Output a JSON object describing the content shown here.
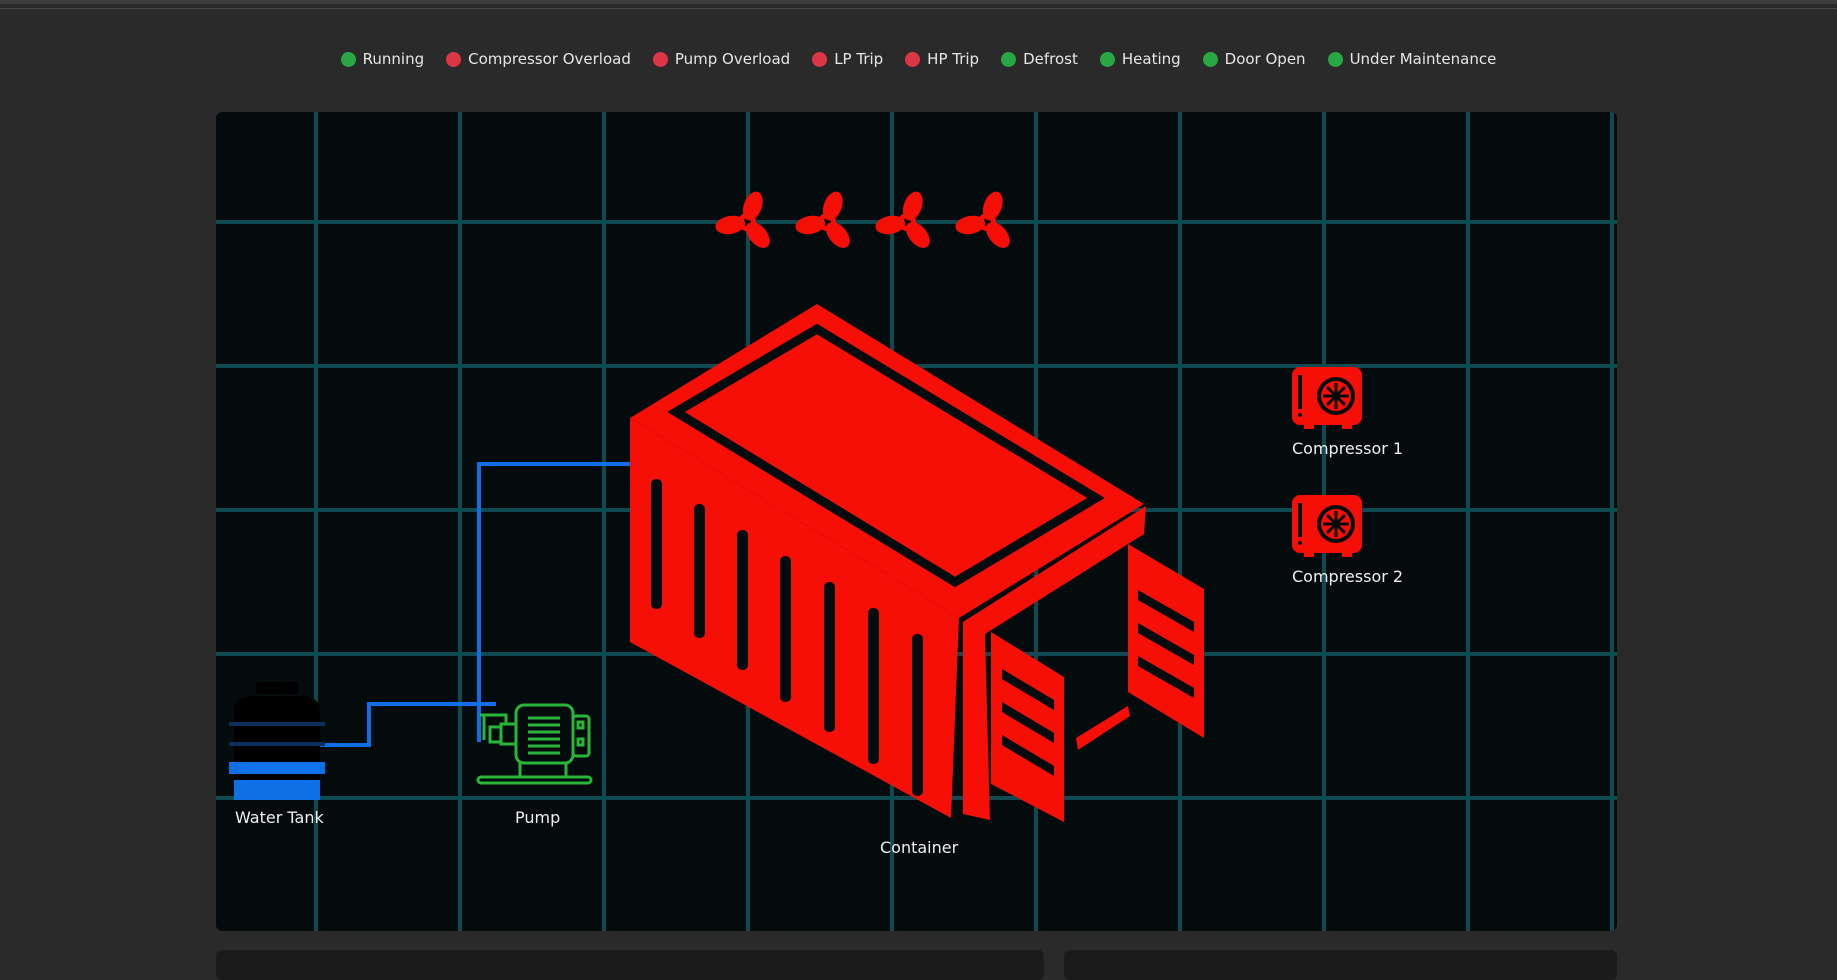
{
  "legend": [
    {
      "label": "Running",
      "color": "#28a745"
    },
    {
      "label": "Compressor Overload",
      "color": "#dc3545"
    },
    {
      "label": "Pump Overload",
      "color": "#dc3545"
    },
    {
      "label": "LP Trip",
      "color": "#dc3545"
    },
    {
      "label": "HP Trip",
      "color": "#dc3545"
    },
    {
      "label": "Defrost",
      "color": "#28a745"
    },
    {
      "label": "Heating",
      "color": "#28a745"
    },
    {
      "label": "Door Open",
      "color": "#28a745"
    },
    {
      "label": "Under Maintenance",
      "color": "#28a745"
    }
  ],
  "diagram": {
    "water_tank_label": "Water Tank",
    "pump_label": "Pump",
    "container_label": "Container",
    "compressor1_label": "Compressor 1",
    "compressor2_label": "Compressor 2",
    "fan_count": 4
  },
  "colors": {
    "alarm_red": "#f50f07",
    "pipe_blue": "#0f6fe6",
    "pump_green": "#28b53a",
    "grid": "#0f4a52",
    "background": "#040b0d"
  }
}
